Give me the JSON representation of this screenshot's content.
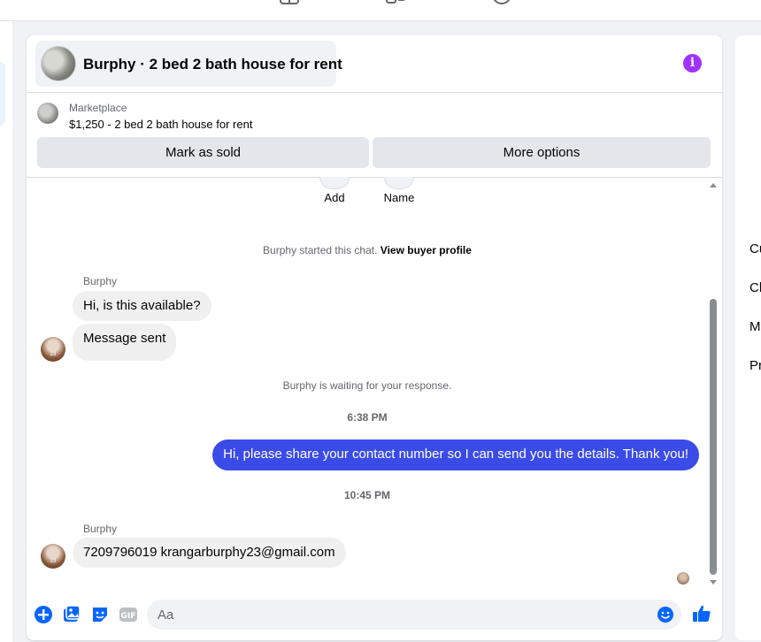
{
  "header": {
    "title": "Burphy · 2 bed 2 bath house for rent"
  },
  "listing": {
    "label": "Marketplace",
    "price_line": "$1,250 - 2 bed 2 bath house for rent"
  },
  "actions": {
    "mark_sold": "Mark as sold",
    "more_options": "More options"
  },
  "quick_actions": {
    "add": "Add",
    "name": "Name"
  },
  "chat": {
    "started_text": "Burphy started this chat.",
    "view_profile": "View buyer profile",
    "sender_1": "Burphy",
    "msg_1": "Hi, is this available?",
    "msg_2": "Message sent",
    "waiting": "Burphy is waiting for your response.",
    "time_1": "6:38 PM",
    "msg_out": "Hi, please share your contact number so I can send you the details. Thank you!",
    "time_2": "10:45 PM",
    "sender_2": "Burphy",
    "msg_3": "7209796019 krangarburphy23@gmail.com"
  },
  "composer": {
    "placeholder": "Aa"
  },
  "right_panel": {
    "items": [
      "Cu",
      "Ch",
      "M",
      "Pr"
    ]
  },
  "colors": {
    "accent": "#0866ff",
    "outgoing_bubble": "#3b4be8",
    "info_icon": "#a033ff"
  }
}
